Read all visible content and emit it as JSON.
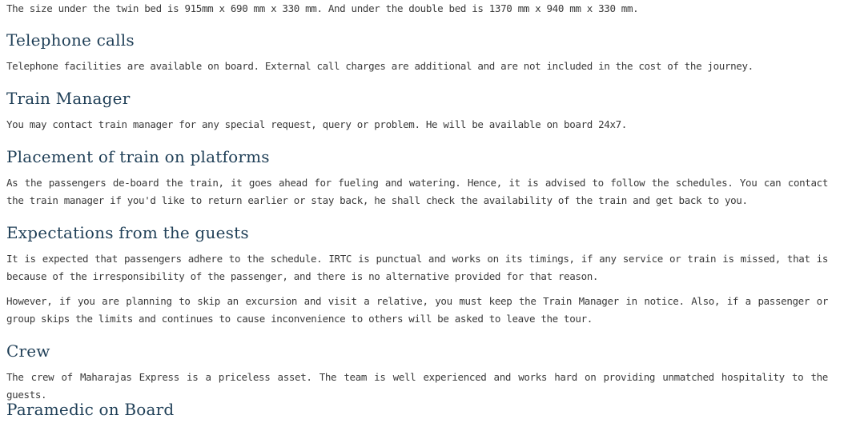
{
  "sections": [
    {
      "paragraph": "The size under the twin bed is 915mm x 690 mm x 330 mm. And under the double bed is 1370 mm x 940 mm x 330 mm."
    },
    {
      "heading": "Telephone calls",
      "paragraph": "Telephone facilities are available on board. External call charges are additional and are not included in the cost of the journey."
    },
    {
      "heading": "Train Manager",
      "paragraph": "You may contact train manager for any special request, query or problem. He will be available on board 24x7."
    },
    {
      "heading": "Placement of train on platforms",
      "paragraph": "As the passengers de-board the train, it goes ahead for fueling and watering. Hence, it is advised to follow the schedules. You can contact the train manager if you'd like to return earlier or stay back, he shall check the availability of the train and get back to you."
    },
    {
      "heading": "Expectations from the guests",
      "paragraph": "It is expected that passengers adhere to the schedule. IRTC is punctual and works on its timings, if any service or train is missed, that is because of the irresponsibility of the passenger, and there is no alternative provided for that reason.",
      "paragraph2": "However, if you are planning to skip an excursion and visit a relative, you must keep the Train Manager in notice. Also, if a passenger or group skips the limits and continues to cause inconvenience to others will be asked to leave the tour."
    },
    {
      "heading": "Crew",
      "paragraph": "The crew of Maharajas Express is a priceless asset. The team is well experienced and works hard on providing unmatched hospitality to the guests."
    },
    {
      "heading": "Paramedic on Board"
    }
  ]
}
